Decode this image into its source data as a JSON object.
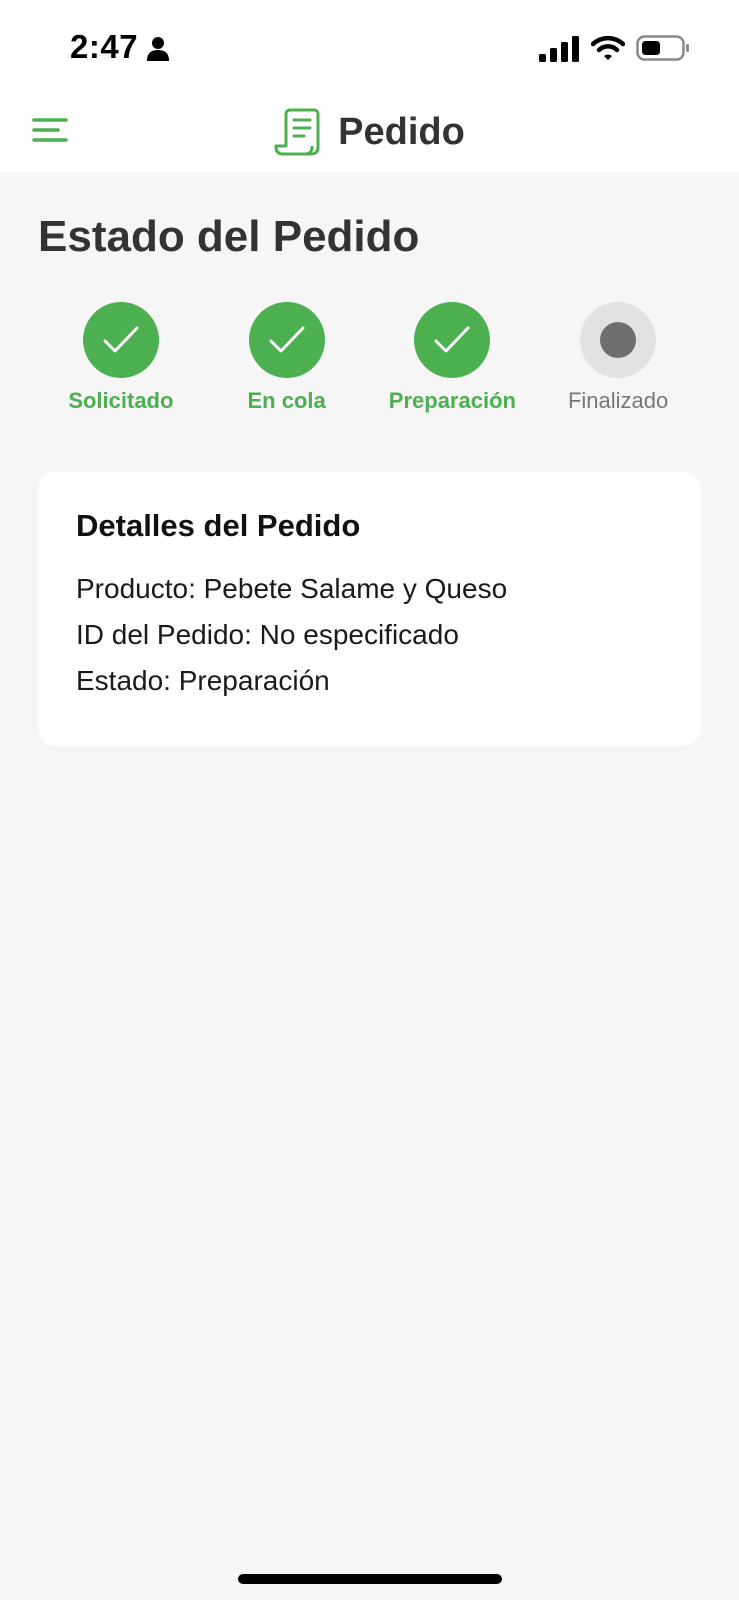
{
  "status_bar": {
    "time": "2:47",
    "icons": [
      "person-icon",
      "signal-icon",
      "wifi-icon",
      "battery-icon"
    ]
  },
  "header": {
    "title": "Pedido",
    "icons": [
      "menu-icon",
      "receipt-icon"
    ]
  },
  "page": {
    "title": "Estado del Pedido"
  },
  "steps": [
    {
      "label": "Solicitado",
      "status": "done"
    },
    {
      "label": "En cola",
      "status": "done"
    },
    {
      "label": "Preparación",
      "status": "done"
    },
    {
      "label": "Finalizado",
      "status": "pending"
    }
  ],
  "details": {
    "title": "Detalles del Pedido",
    "producto": "Producto: Pebete Salame y Queso",
    "id_pedido": "ID del Pedido: No especificado",
    "estado": "Estado: Preparación"
  },
  "colors": {
    "accent": "#4caf50",
    "pending_circle": "#e2e2e2",
    "pending_dot": "#6f6f6f",
    "background": "#f6f6f6"
  }
}
